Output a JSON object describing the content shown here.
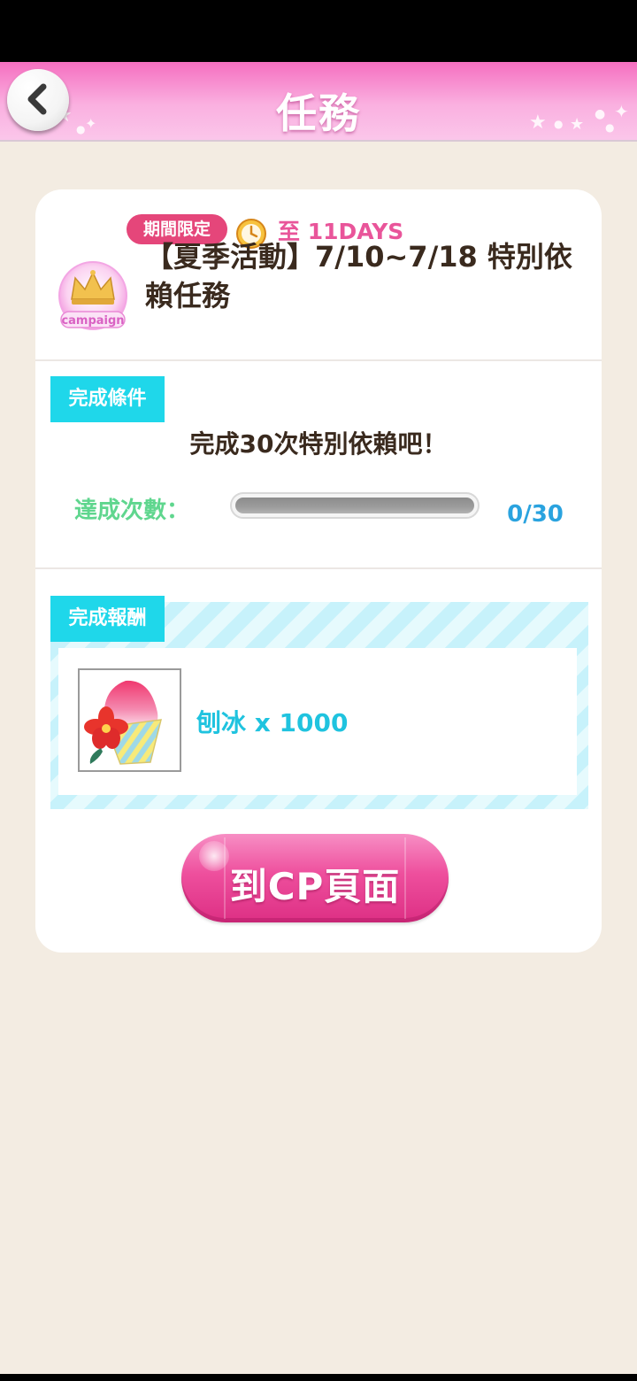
{
  "header": {
    "title": "任務",
    "back_icon": "chevron-left-icon",
    "colors": {
      "gradient_top": "#f56fc0",
      "gradient_bottom": "#fbc6ea"
    }
  },
  "mission": {
    "badge_icon": "campaign-crown-icon",
    "badge_text": "campaign",
    "limited_tag": "期間限定",
    "time_icon": "clock-icon",
    "time_left": "至 11DAYS",
    "title": "【夏季活動】7/10~7/18 特別依賴任務"
  },
  "condition": {
    "section_label": "完成條件",
    "text": "完成30次特別依賴吧！",
    "progress_label": "達成次數：",
    "progress_count": "0/30",
    "progress_value": 0,
    "progress_max": 30
  },
  "reward": {
    "section_label": "完成報酬",
    "item_icon": "shaved-ice-icon",
    "item_label": "刨冰 x 1000"
  },
  "action": {
    "cp_button_label": "到CP頁面"
  }
}
